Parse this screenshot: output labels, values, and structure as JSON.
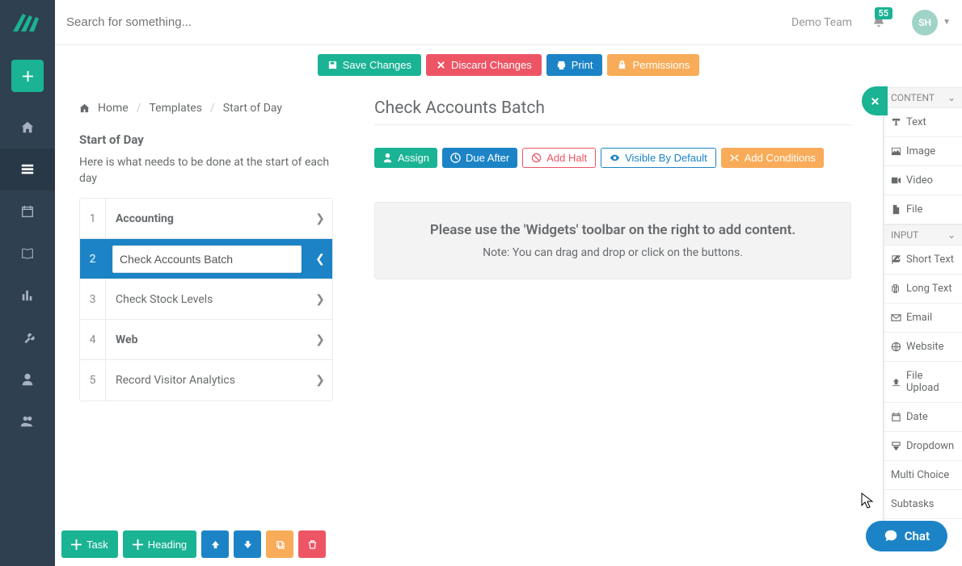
{
  "search": {
    "placeholder": "Search for something..."
  },
  "team": "Demo Team",
  "notif_count": "55",
  "avatar_initials": "SH",
  "toolbar": {
    "save": "Save Changes",
    "discard": "Discard Changes",
    "print": "Print",
    "permissions": "Permissions"
  },
  "breadcrumb": {
    "home": "Home",
    "templates": "Templates",
    "current": "Start of Day"
  },
  "panel": {
    "title": "Start of Day",
    "description": "Here is what needs to be done at the start of each day",
    "items": [
      {
        "num": "1",
        "label": "Accounting",
        "heading": true
      },
      {
        "num": "2",
        "label": "Check Accounts Batch",
        "active": true
      },
      {
        "num": "3",
        "label": "Check Stock Levels"
      },
      {
        "num": "4",
        "label": "Web",
        "heading": true
      },
      {
        "num": "5",
        "label": "Record Visitor Analytics"
      }
    ]
  },
  "detail": {
    "title": "Check Accounts Batch",
    "actions": {
      "assign": "Assign",
      "due_after": "Due After",
      "add_halt": "Add Halt",
      "visible": "Visible By Default",
      "conditions": "Add Conditions"
    },
    "drop": {
      "main": "Please use the 'Widgets' toolbar on the right to add content.",
      "sub": "Note: You can drag and drop or click on the buttons."
    }
  },
  "widgets": {
    "content_header": "CONTENT",
    "content": [
      {
        "key": "text",
        "label": "Text"
      },
      {
        "key": "image",
        "label": "Image"
      },
      {
        "key": "video",
        "label": "Video"
      },
      {
        "key": "file",
        "label": "File"
      }
    ],
    "input_header": "INPUT",
    "input": [
      {
        "key": "short-text",
        "label": "Short Text"
      },
      {
        "key": "long-text",
        "label": "Long Text"
      },
      {
        "key": "email",
        "label": "Email"
      },
      {
        "key": "website",
        "label": "Website"
      },
      {
        "key": "file-upload",
        "label": "File Upload"
      },
      {
        "key": "date",
        "label": "Date"
      },
      {
        "key": "dropdown",
        "label": "Dropdown"
      },
      {
        "key": "multi-choice",
        "label": "Multi Choice"
      },
      {
        "key": "subtasks",
        "label": "Subtasks"
      }
    ]
  },
  "bottom": {
    "task": "Task",
    "heading": "Heading"
  },
  "chat": "Chat"
}
